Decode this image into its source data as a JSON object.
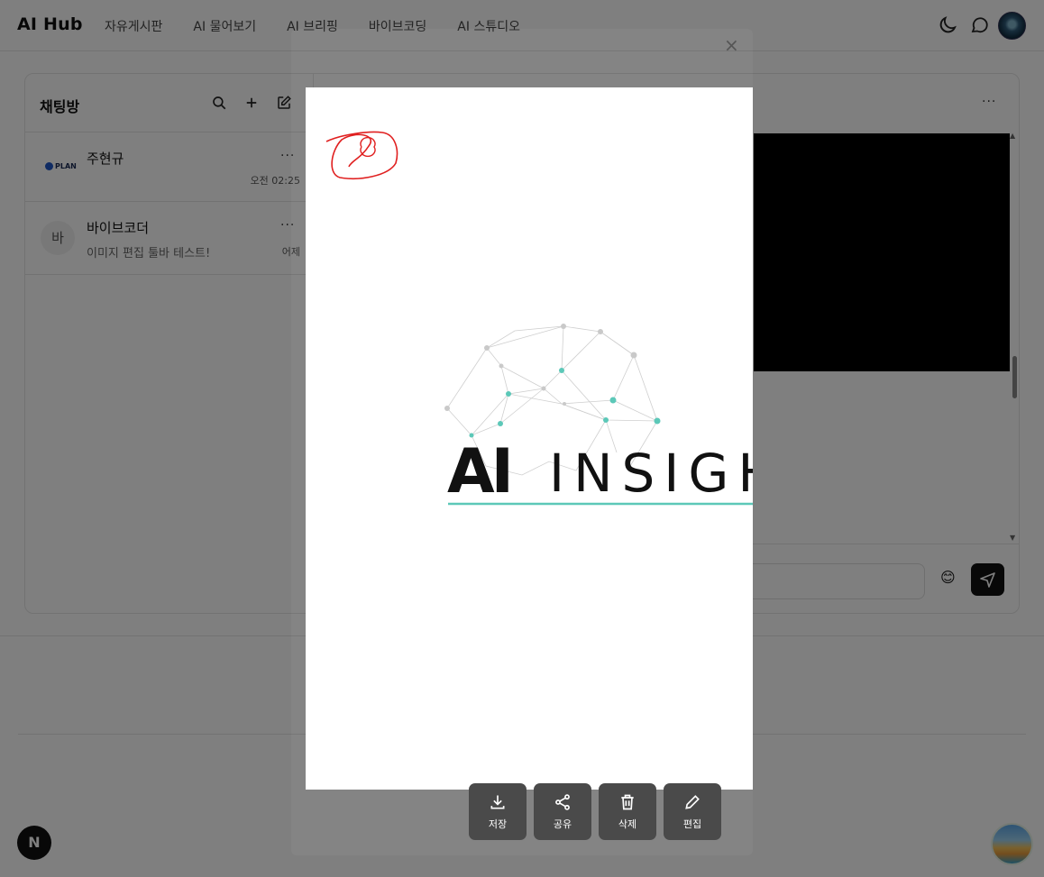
{
  "header": {
    "logo": "AI Hub",
    "nav": [
      "자유게시판",
      "AI 물어보기",
      "AI 브리핑",
      "바이브코딩",
      "AI 스튜디오"
    ]
  },
  "sidebar": {
    "title": "채팅방",
    "rooms": [
      {
        "name": "주현규",
        "avatar_text": "PLAN",
        "last_message": "",
        "time": "오전 02:25",
        "more": "···"
      },
      {
        "name": "바이브코더",
        "avatar_text": "바",
        "last_message": "이미지 편집 툴바 테스트!",
        "time": "어제",
        "more": "···"
      }
    ]
  },
  "main": {
    "more": "···",
    "emoji": "😊"
  },
  "modal": {
    "close": "×",
    "image_text": "AI INSIGH",
    "toolbar": [
      {
        "icon": "download-icon",
        "label": "저장"
      },
      {
        "icon": "share-icon",
        "label": "공유"
      },
      {
        "icon": "trash-icon",
        "label": "삭제"
      },
      {
        "icon": "pencil-icon",
        "label": "편집"
      }
    ]
  },
  "footer": {
    "badge": "N"
  },
  "colors": {
    "accent": "#5cc8b8",
    "overlay": "rgba(0,0,0,0.5)",
    "toolbar_bg": "#4a4a4a"
  }
}
